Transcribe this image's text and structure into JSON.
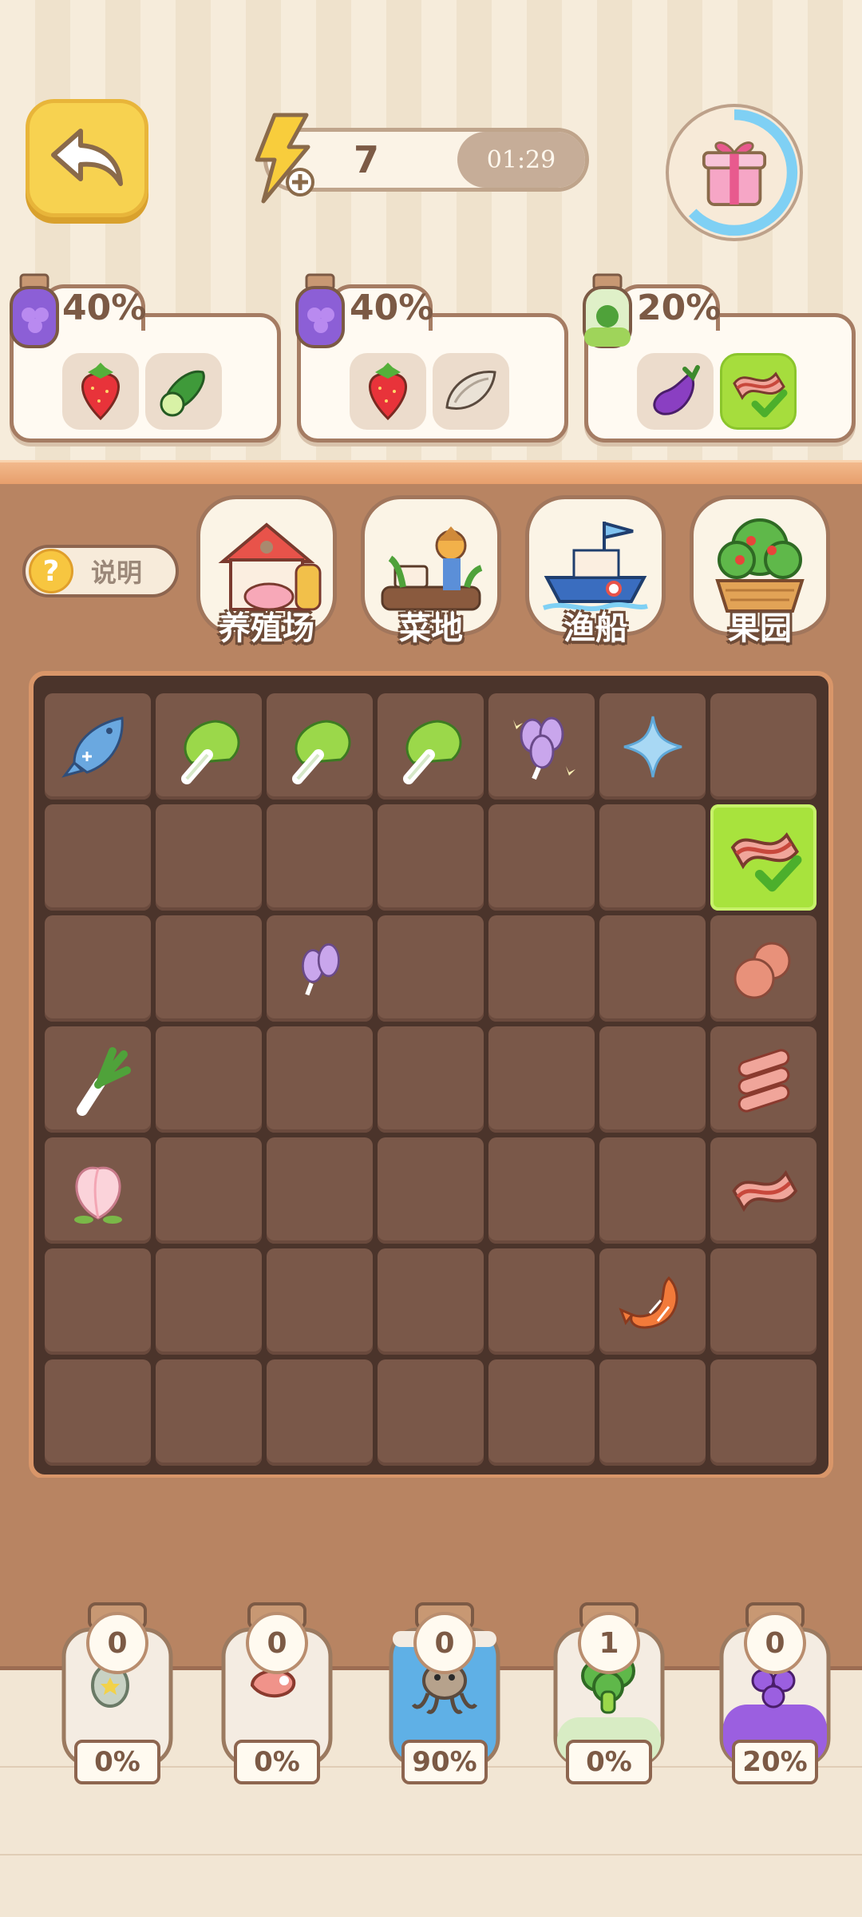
{
  "energy": {
    "value": "7",
    "timer": "01:29"
  },
  "orders": [
    {
      "percent": "40%",
      "items": [
        "strawberry-icon",
        "cucumber-icon"
      ],
      "completed": [
        false,
        false
      ]
    },
    {
      "percent": "40%",
      "items": [
        "strawberry-icon",
        "oyster-icon"
      ],
      "completed": [
        false,
        false
      ]
    },
    {
      "percent": "20%",
      "items": [
        "eggplant-icon",
        "bacon-icon"
      ],
      "completed": [
        false,
        true
      ]
    }
  ],
  "help": {
    "label": "说明"
  },
  "categories": [
    {
      "label": "养殖场",
      "icon": "farm-icon"
    },
    {
      "label": "菜地",
      "icon": "vegetable-field-icon"
    },
    {
      "label": "渔船",
      "icon": "fishing-boat-icon"
    },
    {
      "label": "果园",
      "icon": "orchard-icon"
    }
  ],
  "grid": [
    [
      "fish",
      "cabbage",
      "cabbage",
      "cabbage",
      "purple-radish-bunch",
      "sparkle",
      ""
    ],
    [
      "",
      "",
      "",
      "",
      "",
      "",
      "bacon-check"
    ],
    [
      "",
      "",
      "purple-radish",
      "",
      "",
      "",
      "meatballs"
    ],
    [
      "leek",
      "",
      "",
      "",
      "",
      "",
      "meat-rolls"
    ],
    [
      "peach",
      "",
      "",
      "",
      "",
      "",
      "bacon"
    ],
    [
      "",
      "",
      "",
      "",
      "",
      "shrimp",
      ""
    ],
    [
      "",
      "",
      "",
      "",
      "",
      "",
      ""
    ]
  ],
  "jars": [
    {
      "count": "0",
      "percent": "0%",
      "icon": "badge-icon"
    },
    {
      "count": "0",
      "percent": "0%",
      "icon": "meat-icon"
    },
    {
      "count": "0",
      "percent": "90%",
      "icon": "octopus-icon",
      "fill": 0.9
    },
    {
      "count": "1",
      "percent": "0%",
      "icon": "broccoli-icon"
    },
    {
      "count": "0",
      "percent": "20%",
      "icon": "grape-icon",
      "fill": 0.2
    }
  ],
  "colors": {
    "accent": "#f7d250",
    "highlight": "#a8e33d",
    "panel": "#b88462",
    "board": "#4b342b"
  }
}
